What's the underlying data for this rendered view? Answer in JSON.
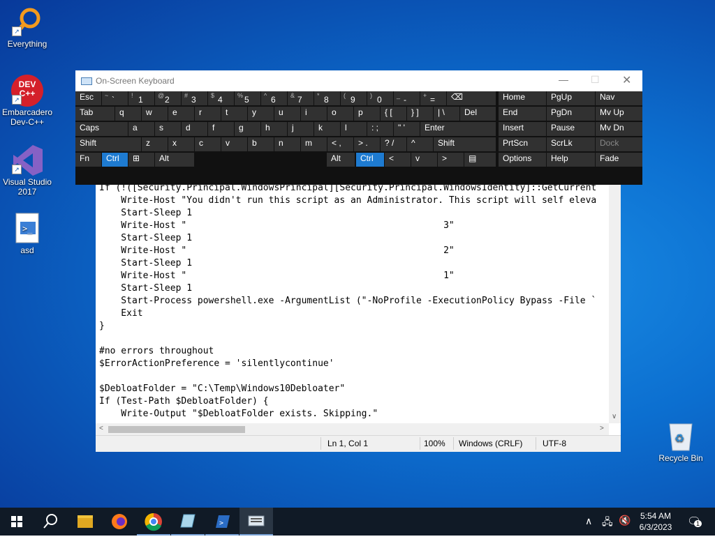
{
  "desktop": {
    "icons": [
      {
        "label": "Everything",
        "icon": "magnifier-orange-icon"
      },
      {
        "label": "Embarcadero Dev-C++",
        "icon": "devcpp-icon"
      },
      {
        "label": "Visual Studio 2017",
        "icon": "visual-studio-icon"
      },
      {
        "label": "asd",
        "icon": "powershell-script-icon"
      },
      {
        "label": "Recycle Bin",
        "icon": "recycle-bin-icon"
      }
    ],
    "devcpp_text": "DEV C++"
  },
  "osk": {
    "title": "On-Screen Keyboard",
    "rows": [
      [
        "Esc",
        "~ `",
        "! 1",
        "@ 2",
        "# 3",
        "$ 4",
        "% 5",
        "^ 6",
        "& 7",
        "* 8",
        "( 9",
        ") 0",
        "_ -",
        "+ =",
        "⌫"
      ],
      [
        "Tab",
        "q",
        "w",
        "e",
        "r",
        "t",
        "y",
        "u",
        "i",
        "o",
        "p",
        "{ [",
        "} ]",
        "| \\",
        "Del"
      ],
      [
        "Caps",
        "a",
        "s",
        "d",
        "f",
        "g",
        "h",
        "j",
        "k",
        "l",
        ": ;",
        "\" '",
        "Enter"
      ],
      [
        "Shift",
        "z",
        "x",
        "c",
        "v",
        "b",
        "n",
        "m",
        "< ,",
        "> .",
        "? /",
        "^",
        "Shift"
      ],
      [
        "Fn",
        "Ctrl",
        "⊞",
        "Alt",
        "Alt",
        "Ctrl",
        "<",
        "v",
        ">",
        "▤"
      ]
    ],
    "nav": [
      [
        "Home",
        "PgUp",
        "Nav"
      ],
      [
        "End",
        "PgDn",
        "Mv Up"
      ],
      [
        "Insert",
        "Pause",
        "Mv Dn"
      ],
      [
        "PrtScn",
        "ScrLk",
        "Dock"
      ],
      [
        "Options",
        "Help",
        "Fade"
      ]
    ]
  },
  "notepad": {
    "lines": [
      "If (!([Security.Principal.WindowsPrincipal][Security.Principal.WindowsIdentity]::GetCurrent",
      "    Write-Host \"You didn't run this script as an Administrator. This script will self eleva",
      "    Start-Sleep 1",
      "    Write-Host \"                                               3\"",
      "    Start-Sleep 1",
      "    Write-Host \"                                               2\"",
      "    Start-Sleep 1",
      "    Write-Host \"                                               1\"",
      "    Start-Sleep 1",
      "    Start-Process powershell.exe -ArgumentList (\"-NoProfile -ExecutionPolicy Bypass -File `",
      "    Exit",
      "}",
      "",
      "#no errors throughout",
      "$ErrorActionPreference = 'silentlycontinue'",
      "",
      "$DebloatFolder = \"C:\\Temp\\Windows10Debloater\"",
      "If (Test-Path $DebloatFolder) {",
      "    Write-Output \"$DebloatFolder exists. Skipping.\"",
      "}"
    ],
    "status": {
      "position": "Ln 1, Col 1",
      "zoom": "100%",
      "line_ending": "Windows (CRLF)",
      "encoding": "UTF-8"
    }
  },
  "taskbar": {
    "apps": [
      "start-icon",
      "search-icon",
      "file-explorer-icon",
      "firefox-icon",
      "chrome-icon",
      "notepad-icon",
      "powershell-icon",
      "on-screen-keyboard-icon"
    ],
    "time": "5:54 AM",
    "date": "6/3/2023",
    "notification_count": "1"
  }
}
